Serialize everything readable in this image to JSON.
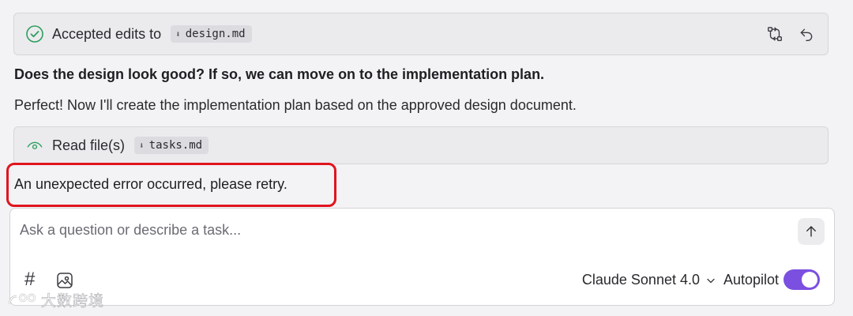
{
  "accepted_card": {
    "label": "Accepted edits to",
    "file": "design.md",
    "icons": [
      "check-circle-icon",
      "compare-diff-icon",
      "undo-icon"
    ]
  },
  "question": "Does the design look good? If so, we can move on to the implementation plan.",
  "reply": "Perfect! Now I'll create the implementation plan based on the approved design document.",
  "read_card": {
    "label": "Read file(s)",
    "file": "tasks.md",
    "icons": [
      "eye-icon"
    ]
  },
  "error": {
    "message": "An unexpected error occurred, please retry.",
    "highlight_color": "#e0141e"
  },
  "composer": {
    "placeholder": "Ask a question or describe a task...",
    "model": "Claude Sonnet 4.0",
    "autopilot_label": "Autopilot",
    "autopilot_on": true,
    "toggle_color": "#7b4fe0",
    "icons": [
      "hash-icon",
      "image-icon",
      "send-arrow-icon",
      "chevron-down-icon"
    ]
  },
  "watermark": {
    "text": "大数跨境"
  }
}
